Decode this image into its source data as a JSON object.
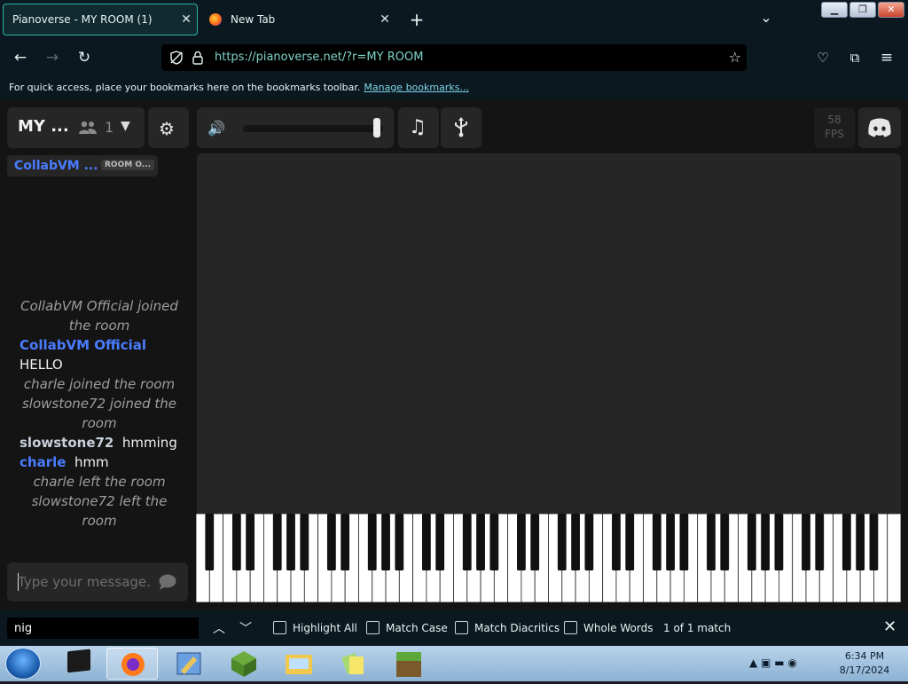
{
  "browser": {
    "tabs": [
      {
        "title": "Pianoverse - MY ROOM (1)",
        "active": true
      },
      {
        "title": "New Tab",
        "active": false
      }
    ],
    "url": "https://pianoverse.net/?r=MY ROOM",
    "bookmarks_bar": {
      "message": "For quick access, place your bookmarks here on the bookmarks toolbar.",
      "link": "Manage bookmarks..."
    }
  },
  "room": {
    "name": "MY ...",
    "user_count": "1",
    "fps_value": "58",
    "fps_label": "FPS",
    "volume_level": 0.98
  },
  "user_tag": {
    "name": "CollabVM ...",
    "badge": "ROOM O..."
  },
  "chat": {
    "messages": [
      {
        "type": "system",
        "text": "CollabVM Official joined the room"
      },
      {
        "type": "message",
        "user": "CollabVM Official",
        "text": "HELLO",
        "color": "#4a7cff"
      },
      {
        "type": "system",
        "text": "charle joined the room"
      },
      {
        "type": "system",
        "text": "slowstone72 joined the room"
      },
      {
        "type": "message",
        "user": "slowstone72",
        "text": "hmming",
        "color": "#c8d0dc"
      },
      {
        "type": "message",
        "user": "charle",
        "text": "hmm",
        "color": "#4a7cff"
      },
      {
        "type": "system",
        "text": "charle left the room"
      },
      {
        "type": "system",
        "text": "slowstone72 left the room"
      }
    ],
    "input_placeholder": "Type your message..."
  },
  "findbar": {
    "query": "nig",
    "highlight_all": "Highlight All",
    "match_case": "Match Case",
    "match_diacritics": "Match Diacritics",
    "whole_words": "Whole Words",
    "result": "1 of 1 match"
  },
  "taskbar": {
    "time": "6:34 PM",
    "date": "8/17/2024"
  },
  "colors": {
    "accent": "#2ab6a6",
    "panel": "#262626",
    "username_blue": "#4a7cff"
  }
}
